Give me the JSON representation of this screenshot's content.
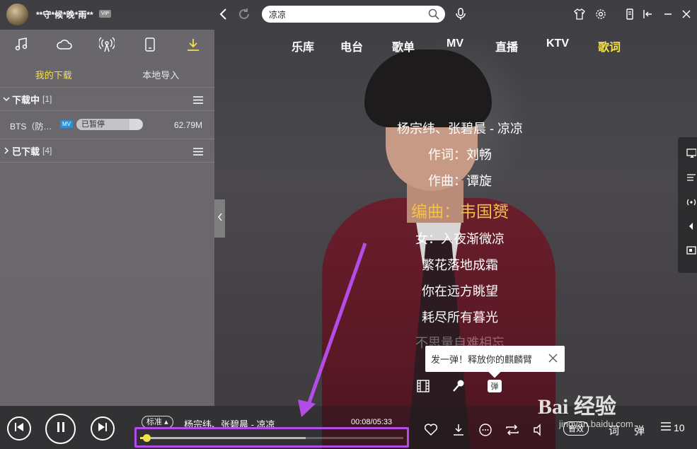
{
  "header": {
    "username": "**守*候*晚*雨**",
    "vip_badge": "VIP",
    "search_value": "凉凉"
  },
  "sidebar": {
    "tab_icons": [
      "music-icon",
      "cloud-icon",
      "radio-icon",
      "device-icon",
      "download-icon"
    ],
    "sub_tabs": [
      "我的下载",
      "本地导入"
    ],
    "downloading": {
      "title": "下载中",
      "count": "[1]",
      "items": [
        {
          "name": "BTS（防…",
          "badge": "MV",
          "status": "已暂停",
          "progress": 0.8,
          "size": "62.79M"
        }
      ]
    },
    "downloaded": {
      "title": "已下载",
      "count": "[4]"
    }
  },
  "main_nav": {
    "items": [
      "乐库",
      "电台",
      "歌单",
      "MV",
      "直播",
      "KTV",
      "歌词"
    ],
    "active": "歌词"
  },
  "lyrics": {
    "lines": [
      "杨宗纬、张碧晨 - 凉凉",
      "作词：刘畅",
      "作曲：谭旋",
      "编曲：韦国赟",
      "女：入夜渐微凉",
      "繁花落地成霜",
      "你在远方眺望",
      "耗尽所有暮光",
      "不思量自难相忘"
    ],
    "current_index": 3
  },
  "tooltip": {
    "text": "发一弹！释放你的麒麟臂",
    "danmu_label": "弹"
  },
  "player": {
    "quality": "标准",
    "song": "杨宗纬、张碧晨 - 凉凉",
    "time": "00:08/05:33",
    "progress": 0.025,
    "buffered": 0.63,
    "sound_label": "音效",
    "lyric_label": "词",
    "danmu_label": "弹",
    "playlist_count": "10"
  },
  "watermark": {
    "main": "Bai 经验",
    "sub": "jingyan.baidu.com"
  },
  "colors": {
    "accent": "#f3e04a",
    "current_lyric": "#f5c04a",
    "annotation": "#b44ce8"
  }
}
